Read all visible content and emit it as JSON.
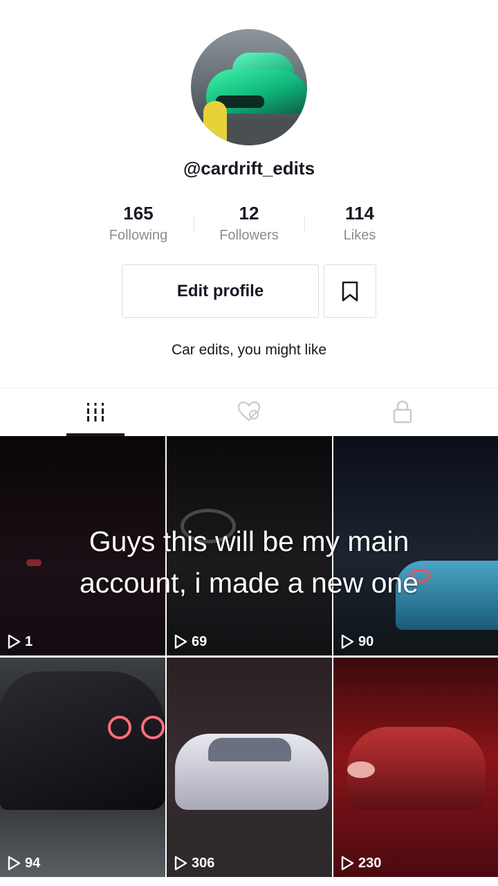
{
  "profile": {
    "username": "@cardrift_edits",
    "bio": "Car edits, you might like"
  },
  "stats": [
    {
      "value": "165",
      "label": "Following"
    },
    {
      "value": "12",
      "label": "Followers"
    },
    {
      "value": "114",
      "label": "Likes"
    }
  ],
  "actions": {
    "edit_profile_label": "Edit profile",
    "bookmark_icon": "bookmark-icon"
  },
  "tabs": [
    {
      "icon": "grid-icon",
      "active": true
    },
    {
      "icon": "liked-hidden-icon",
      "active": false
    },
    {
      "icon": "lock-icon",
      "active": false
    }
  ],
  "videos": [
    {
      "views": "1"
    },
    {
      "views": "69"
    },
    {
      "views": "90"
    },
    {
      "views": "94"
    },
    {
      "views": "306"
    },
    {
      "views": "230"
    }
  ],
  "overlay": {
    "line1": "Guys this will be my main",
    "line2": "account, i made a new one"
  },
  "colors": {
    "text": "#161823",
    "secondary_text": "#8a8b91",
    "border": "#dcdcde"
  }
}
